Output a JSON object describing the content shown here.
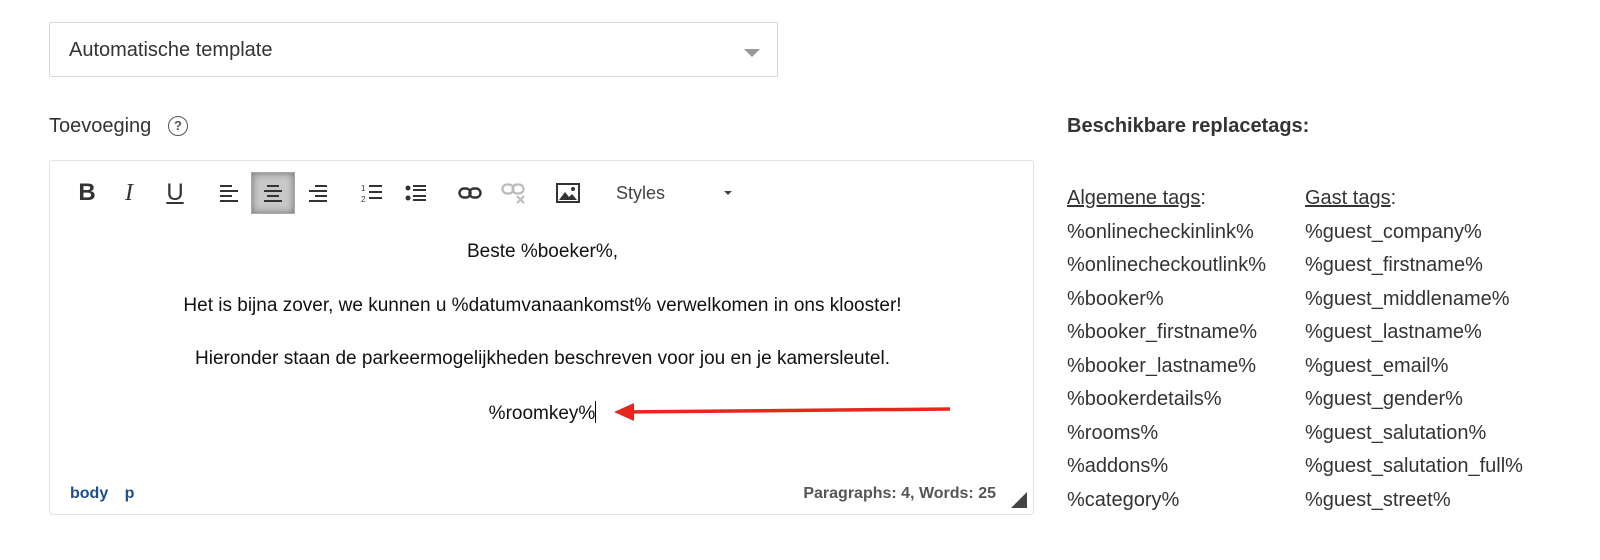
{
  "template_select": {
    "value": "Automatische template"
  },
  "addition": {
    "label": "Toevoeging",
    "help": "?"
  },
  "toolbar": {
    "bold": "B",
    "italic": "I",
    "underline": "U",
    "styles_label": "Styles"
  },
  "editor": {
    "paragraphs": [
      "Beste %boeker%,",
      "Het is bijna zover, we kunnen u %datumvanaankomst% verwelkomen in ons klooster!",
      "Hieronder staan de parkeermogelijkheden beschreven voor jou en je kamersleutel.",
      "%roomkey%"
    ],
    "path": [
      "body",
      "p"
    ],
    "wordcount": "Paragraphs: 4, Words: 25"
  },
  "tags": {
    "title": "Beschikbare replacetags:",
    "general": {
      "heading": "Algemene tags",
      "items": [
        "%onlinecheckinlink%",
        "%onlinecheckoutlink%",
        "%booker%",
        "%booker_firstname%",
        "%booker_lastname%",
        "%bookerdetails%",
        "%rooms%",
        "%addons%",
        "%category%"
      ]
    },
    "guest": {
      "heading": "Gast tags",
      "items": [
        "%guest_company%",
        "%guest_firstname%",
        "%guest_middlename%",
        "%guest_lastname%",
        "%guest_email%",
        "%guest_gender%",
        "%guest_salutation%",
        "%guest_salutation_full%",
        "%guest_street%"
      ]
    }
  },
  "colors": {
    "arrow": "#e8261c",
    "path_link": "#1f4e8c",
    "active_button": "#c8c8c8"
  }
}
